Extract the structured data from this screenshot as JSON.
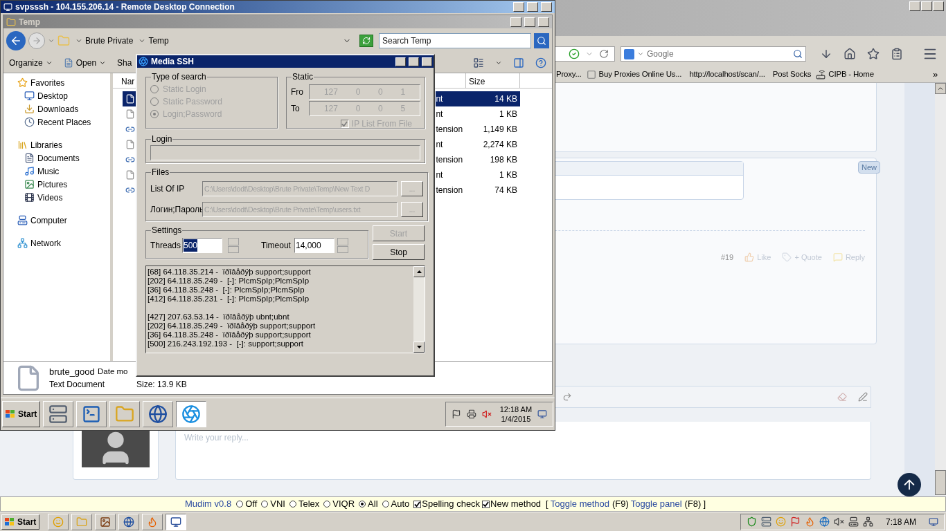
{
  "browser": {
    "search_placeholder": "Google",
    "bookmarks": [
      {
        "label": "Proxy...",
        "kind": "none"
      },
      {
        "label": "Buy Proxies Online Us...",
        "kind": "blank"
      },
      {
        "label": "http://localhost/scan/...",
        "kind": "m"
      },
      {
        "label": "Post Socks",
        "kind": "m"
      },
      {
        "label": "CIPB - Home",
        "kind": "router"
      }
    ],
    "bookmarks_more": "»",
    "post": {
      "badge": "New",
      "number": "#19",
      "actions": [
        {
          "label": "Like",
          "kind": "like"
        },
        {
          "label": "+ Quote",
          "kind": "quote"
        },
        {
          "label": "Reply",
          "kind": "reply"
        }
      ]
    },
    "reply_placeholder": "Write your reply..."
  },
  "rdp": {
    "title": "svpsssh - 104.155.206.14 - Remote Desktop Connection"
  },
  "explorer": {
    "title": "Temp",
    "breadcrumb": [
      "Brute Private",
      "Temp"
    ],
    "search_placeholder": "Search Temp",
    "toolbar": [
      "Organize",
      "Open",
      "Sha"
    ],
    "nav": [
      {
        "label": "Favorites",
        "kind": "star",
        "children": [
          {
            "label": "Desktop",
            "kind": "desktop"
          },
          {
            "label": "Downloads",
            "kind": "download"
          },
          {
            "label": "Recent Places",
            "kind": "recent"
          }
        ]
      },
      {
        "label": "Libraries",
        "kind": "library",
        "children": [
          {
            "label": "Documents",
            "kind": "document"
          },
          {
            "label": "Music",
            "kind": "music"
          },
          {
            "label": "Pictures",
            "kind": "picture"
          },
          {
            "label": "Videos",
            "kind": "video"
          }
        ]
      },
      {
        "label": "Computer",
        "kind": "computer"
      },
      {
        "label": "Network",
        "kind": "network"
      }
    ],
    "columns": [
      "Nar",
      "Size"
    ],
    "rows": [
      {
        "kind": "text",
        "type": "nt",
        "size": "14 KB",
        "selected": true
      },
      {
        "kind": "text",
        "type": "nt",
        "size": "1 KB",
        "selected": false
      },
      {
        "kind": "app",
        "type": "tension",
        "size": "1,149 KB",
        "selected": false
      },
      {
        "kind": "text",
        "type": "nt",
        "size": "2,274 KB",
        "selected": false
      },
      {
        "kind": "app",
        "type": "tension",
        "size": "198 KB",
        "selected": false
      },
      {
        "kind": "text",
        "type": "nt",
        "size": "1 KB",
        "selected": false
      },
      {
        "kind": "app",
        "type": "tension",
        "size": "74 KB",
        "selected": false
      }
    ],
    "details": {
      "name": "brute_good",
      "date_label": "Date mo",
      "type": "Text Document",
      "size": "Size: 13.9 KB"
    }
  },
  "dialog": {
    "title": "Media SSH",
    "search_type": {
      "title": "Type of search",
      "disabled": true,
      "options": [
        {
          "label": "Static Login",
          "selected": false
        },
        {
          "label": "Static Password",
          "selected": false
        },
        {
          "label": "Login;Password",
          "selected": true
        }
      ]
    },
    "static": {
      "title": "Static",
      "disabled": true,
      "from_label": "Fro",
      "to_label": "To",
      "from": [
        "127",
        "0",
        "0",
        "1"
      ],
      "to": [
        "127",
        "0",
        "0",
        "5"
      ],
      "ip_list": {
        "label": "IP List From File",
        "checked": true
      }
    },
    "login": {
      "title": "Login"
    },
    "files": {
      "title": "Files",
      "rows": [
        {
          "label": "List Of IP",
          "value": "C:\\Users\\dodt\\Desktop\\Brute Private\\Temp\\New Text D",
          "button": "..."
        },
        {
          "label": "Логин;Пароль",
          "value": "C:\\Users\\dodt\\Desktop\\Brute Private\\Temp\\users.txt",
          "button": "..."
        }
      ]
    },
    "settings": {
      "title": "Settings",
      "threads_label": "Threads",
      "threads": "500",
      "timeout_label": "Timeout",
      "timeout": "14,000"
    },
    "buttons": [
      {
        "label": "Start",
        "disabled": true
      },
      {
        "label": "Stop",
        "disabled": false
      }
    ],
    "log": [
      {
        "text": "[68] 64.118.35.214 -  ïðîâåðÿþ support;support",
        "gap_before": false
      },
      {
        "text": "[202] 64.118.35.249 -  [-]: PlcmSpIp;PlcmSpIp",
        "gap_before": false
      },
      {
        "text": "[36] 64.118.35.248 -  [-]: PlcmSpIp;PlcmSpIp",
        "gap_before": false
      },
      {
        "text": "[412] 64.118.35.231 -  [-]: PlcmSpIp;PlcmSpIp",
        "gap_before": false
      },
      {
        "text": "[427] 207.63.53.14 -  ïðîâåðÿþ ubnt;ubnt",
        "gap_before": true
      },
      {
        "text": "[202] 64.118.35.249 -  ïðîâåðÿþ support;support",
        "gap_before": false
      },
      {
        "text": "[36] 64.118.35.248 -  ïðîâåðÿþ support;support",
        "gap_before": false
      },
      {
        "text": "[500] 216.243.192.193 -  [-]: support;support",
        "gap_before": false
      }
    ]
  },
  "remote_taskbar": {
    "start": "Start",
    "apps": [
      {
        "kind": "server",
        "selected": false
      },
      {
        "kind": "terminal",
        "selected": false
      },
      {
        "kind": "folder",
        "selected": false
      },
      {
        "kind": "globe",
        "selected": false
      },
      {
        "kind": "aperture",
        "selected": true
      }
    ],
    "time": "12:18 AM",
    "date": "1/4/2015"
  },
  "mudim": {
    "title": "Mudim v0.8",
    "modes": [
      {
        "label": "Off",
        "selected": false
      },
      {
        "label": "VNI",
        "selected": false
      },
      {
        "label": "Telex",
        "selected": false
      },
      {
        "label": "VIQR",
        "selected": false
      },
      {
        "label": "All",
        "selected": true
      },
      {
        "label": "Auto",
        "selected": false
      }
    ],
    "checks": [
      {
        "label": "Spelling check",
        "checked": true
      },
      {
        "label": "New method",
        "checked": true
      }
    ],
    "bracket_open": "[",
    "links": [
      {
        "label": "Toggle method",
        "key": "(F9)"
      },
      {
        "label": "Toggle panel",
        "key": "(F8)"
      }
    ],
    "bracket_close": "]"
  },
  "host_taskbar": {
    "start": "Start",
    "apps": [
      {
        "kind": "smiley",
        "selected": false
      },
      {
        "kind": "folder",
        "selected": false
      },
      {
        "kind": "image",
        "selected": false
      },
      {
        "kind": "globe",
        "selected": false
      },
      {
        "kind": "flame",
        "selected": false
      },
      {
        "kind": "monitor",
        "selected": true
      }
    ],
    "time": "7:18 AM"
  }
}
